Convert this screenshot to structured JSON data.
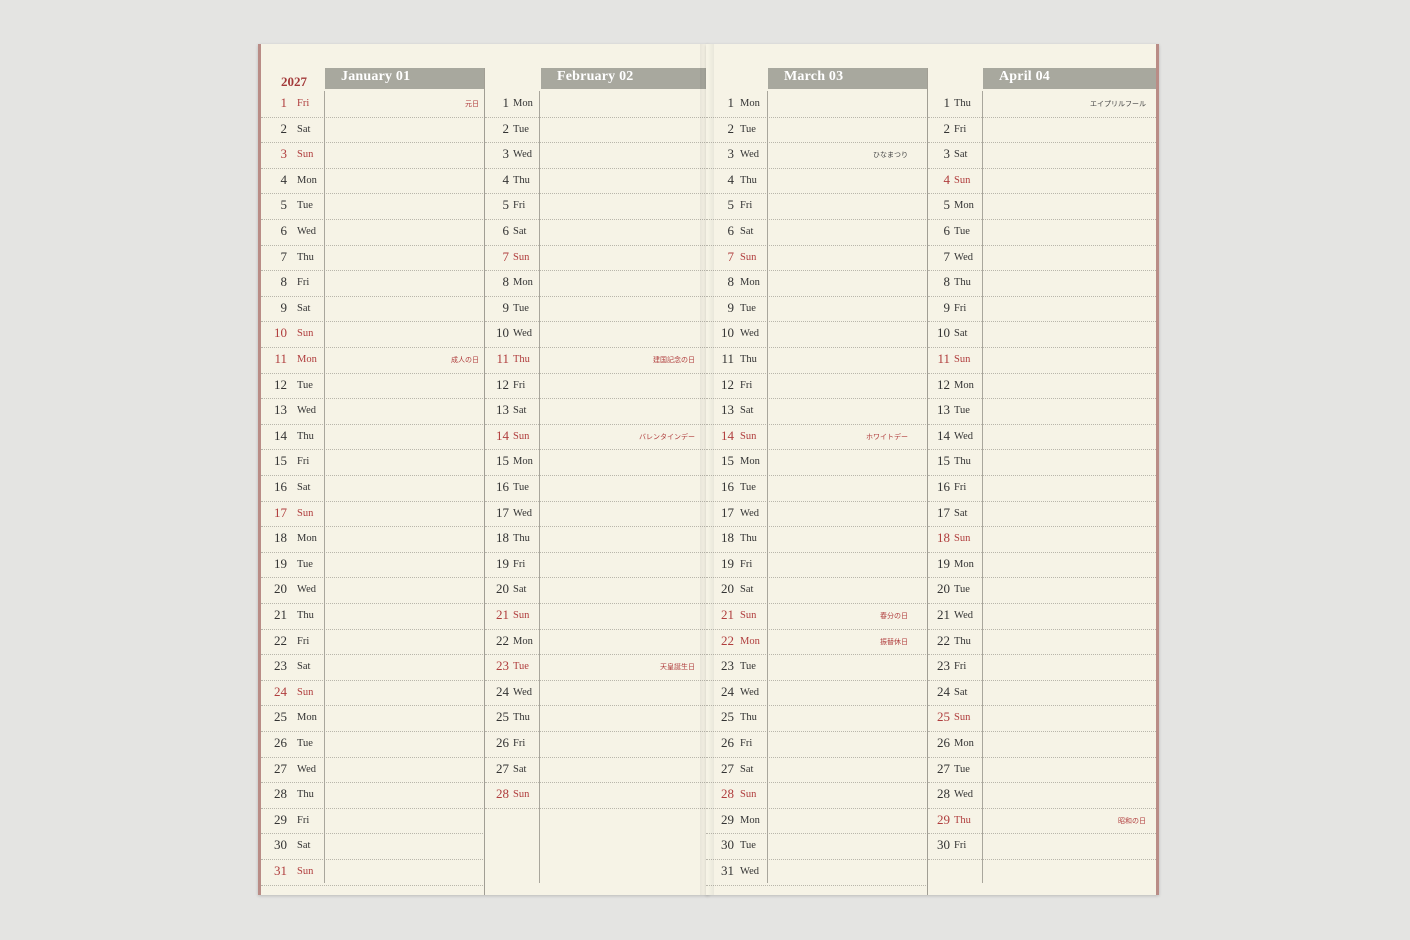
{
  "year": "2027",
  "months": [
    {
      "title": "January 01",
      "days": [
        {
          "d": "1",
          "w": "Fri",
          "hol": true,
          "note": "元日"
        },
        {
          "d": "2",
          "w": "Sat"
        },
        {
          "d": "3",
          "w": "Sun",
          "hol": true
        },
        {
          "d": "4",
          "w": "Mon"
        },
        {
          "d": "5",
          "w": "Tue"
        },
        {
          "d": "6",
          "w": "Wed"
        },
        {
          "d": "7",
          "w": "Thu"
        },
        {
          "d": "8",
          "w": "Fri"
        },
        {
          "d": "9",
          "w": "Sat"
        },
        {
          "d": "10",
          "w": "Sun",
          "hol": true
        },
        {
          "d": "11",
          "w": "Mon",
          "hol": true,
          "note": "成人の日"
        },
        {
          "d": "12",
          "w": "Tue"
        },
        {
          "d": "13",
          "w": "Wed"
        },
        {
          "d": "14",
          "w": "Thu"
        },
        {
          "d": "15",
          "w": "Fri"
        },
        {
          "d": "16",
          "w": "Sat"
        },
        {
          "d": "17",
          "w": "Sun",
          "hol": true
        },
        {
          "d": "18",
          "w": "Mon"
        },
        {
          "d": "19",
          "w": "Tue"
        },
        {
          "d": "20",
          "w": "Wed"
        },
        {
          "d": "21",
          "w": "Thu"
        },
        {
          "d": "22",
          "w": "Fri"
        },
        {
          "d": "23",
          "w": "Sat"
        },
        {
          "d": "24",
          "w": "Sun",
          "hol": true
        },
        {
          "d": "25",
          "w": "Mon"
        },
        {
          "d": "26",
          "w": "Tue"
        },
        {
          "d": "27",
          "w": "Wed"
        },
        {
          "d": "28",
          "w": "Thu"
        },
        {
          "d": "29",
          "w": "Fri"
        },
        {
          "d": "30",
          "w": "Sat"
        },
        {
          "d": "31",
          "w": "Sun",
          "hol": true
        }
      ]
    },
    {
      "title": "February 02",
      "days": [
        {
          "d": "1",
          "w": "Mon"
        },
        {
          "d": "2",
          "w": "Tue"
        },
        {
          "d": "3",
          "w": "Wed"
        },
        {
          "d": "4",
          "w": "Thu"
        },
        {
          "d": "5",
          "w": "Fri"
        },
        {
          "d": "6",
          "w": "Sat"
        },
        {
          "d": "7",
          "w": "Sun",
          "hol": true
        },
        {
          "d": "8",
          "w": "Mon"
        },
        {
          "d": "9",
          "w": "Tue"
        },
        {
          "d": "10",
          "w": "Wed"
        },
        {
          "d": "11",
          "w": "Thu",
          "hol": true,
          "note": "建国記念の日"
        },
        {
          "d": "12",
          "w": "Fri"
        },
        {
          "d": "13",
          "w": "Sat"
        },
        {
          "d": "14",
          "w": "Sun",
          "hol": true,
          "note": "バレンタインデー"
        },
        {
          "d": "15",
          "w": "Mon"
        },
        {
          "d": "16",
          "w": "Tue"
        },
        {
          "d": "17",
          "w": "Wed"
        },
        {
          "d": "18",
          "w": "Thu"
        },
        {
          "d": "19",
          "w": "Fri"
        },
        {
          "d": "20",
          "w": "Sat"
        },
        {
          "d": "21",
          "w": "Sun",
          "hol": true
        },
        {
          "d": "22",
          "w": "Mon"
        },
        {
          "d": "23",
          "w": "Tue",
          "hol": true,
          "note": "天皇誕生日"
        },
        {
          "d": "24",
          "w": "Wed"
        },
        {
          "d": "25",
          "w": "Thu"
        },
        {
          "d": "26",
          "w": "Fri"
        },
        {
          "d": "27",
          "w": "Sat"
        },
        {
          "d": "28",
          "w": "Sun",
          "hol": true
        }
      ]
    },
    {
      "title": "March 03",
      "days": [
        {
          "d": "1",
          "w": "Mon"
        },
        {
          "d": "2",
          "w": "Tue"
        },
        {
          "d": "3",
          "w": "Wed",
          "note": "ひなまつり",
          "noteBlack": true
        },
        {
          "d": "4",
          "w": "Thu"
        },
        {
          "d": "5",
          "w": "Fri"
        },
        {
          "d": "6",
          "w": "Sat"
        },
        {
          "d": "7",
          "w": "Sun",
          "hol": true
        },
        {
          "d": "8",
          "w": "Mon"
        },
        {
          "d": "9",
          "w": "Tue"
        },
        {
          "d": "10",
          "w": "Wed"
        },
        {
          "d": "11",
          "w": "Thu"
        },
        {
          "d": "12",
          "w": "Fri"
        },
        {
          "d": "13",
          "w": "Sat"
        },
        {
          "d": "14",
          "w": "Sun",
          "hol": true,
          "note": "ホワイトデー"
        },
        {
          "d": "15",
          "w": "Mon"
        },
        {
          "d": "16",
          "w": "Tue"
        },
        {
          "d": "17",
          "w": "Wed"
        },
        {
          "d": "18",
          "w": "Thu"
        },
        {
          "d": "19",
          "w": "Fri"
        },
        {
          "d": "20",
          "w": "Sat"
        },
        {
          "d": "21",
          "w": "Sun",
          "hol": true,
          "note": "春分の日"
        },
        {
          "d": "22",
          "w": "Mon",
          "hol": true,
          "note": "振替休日"
        },
        {
          "d": "23",
          "w": "Tue"
        },
        {
          "d": "24",
          "w": "Wed"
        },
        {
          "d": "25",
          "w": "Thu"
        },
        {
          "d": "26",
          "w": "Fri"
        },
        {
          "d": "27",
          "w": "Sat"
        },
        {
          "d": "28",
          "w": "Sun",
          "hol": true
        },
        {
          "d": "29",
          "w": "Mon"
        },
        {
          "d": "30",
          "w": "Tue"
        },
        {
          "d": "31",
          "w": "Wed"
        }
      ]
    },
    {
      "title": "April 04",
      "days": [
        {
          "d": "1",
          "w": "Thu",
          "note": "エイプリルフール",
          "noteBlack": true
        },
        {
          "d": "2",
          "w": "Fri"
        },
        {
          "d": "3",
          "w": "Sat"
        },
        {
          "d": "4",
          "w": "Sun",
          "hol": true
        },
        {
          "d": "5",
          "w": "Mon"
        },
        {
          "d": "6",
          "w": "Tue"
        },
        {
          "d": "7",
          "w": "Wed"
        },
        {
          "d": "8",
          "w": "Thu"
        },
        {
          "d": "9",
          "w": "Fri"
        },
        {
          "d": "10",
          "w": "Sat"
        },
        {
          "d": "11",
          "w": "Sun",
          "hol": true
        },
        {
          "d": "12",
          "w": "Mon"
        },
        {
          "d": "13",
          "w": "Tue"
        },
        {
          "d": "14",
          "w": "Wed"
        },
        {
          "d": "15",
          "w": "Thu"
        },
        {
          "d": "16",
          "w": "Fri"
        },
        {
          "d": "17",
          "w": "Sat"
        },
        {
          "d": "18",
          "w": "Sun",
          "hol": true
        },
        {
          "d": "19",
          "w": "Mon"
        },
        {
          "d": "20",
          "w": "Tue"
        },
        {
          "d": "21",
          "w": "Wed"
        },
        {
          "d": "22",
          "w": "Thu"
        },
        {
          "d": "23",
          "w": "Fri"
        },
        {
          "d": "24",
          "w": "Sat"
        },
        {
          "d": "25",
          "w": "Sun",
          "hol": true
        },
        {
          "d": "26",
          "w": "Mon"
        },
        {
          "d": "27",
          "w": "Tue"
        },
        {
          "d": "28",
          "w": "Wed"
        },
        {
          "d": "29",
          "w": "Thu",
          "hol": true,
          "note": "昭和の日"
        },
        {
          "d": "30",
          "w": "Fri"
        }
      ]
    }
  ]
}
